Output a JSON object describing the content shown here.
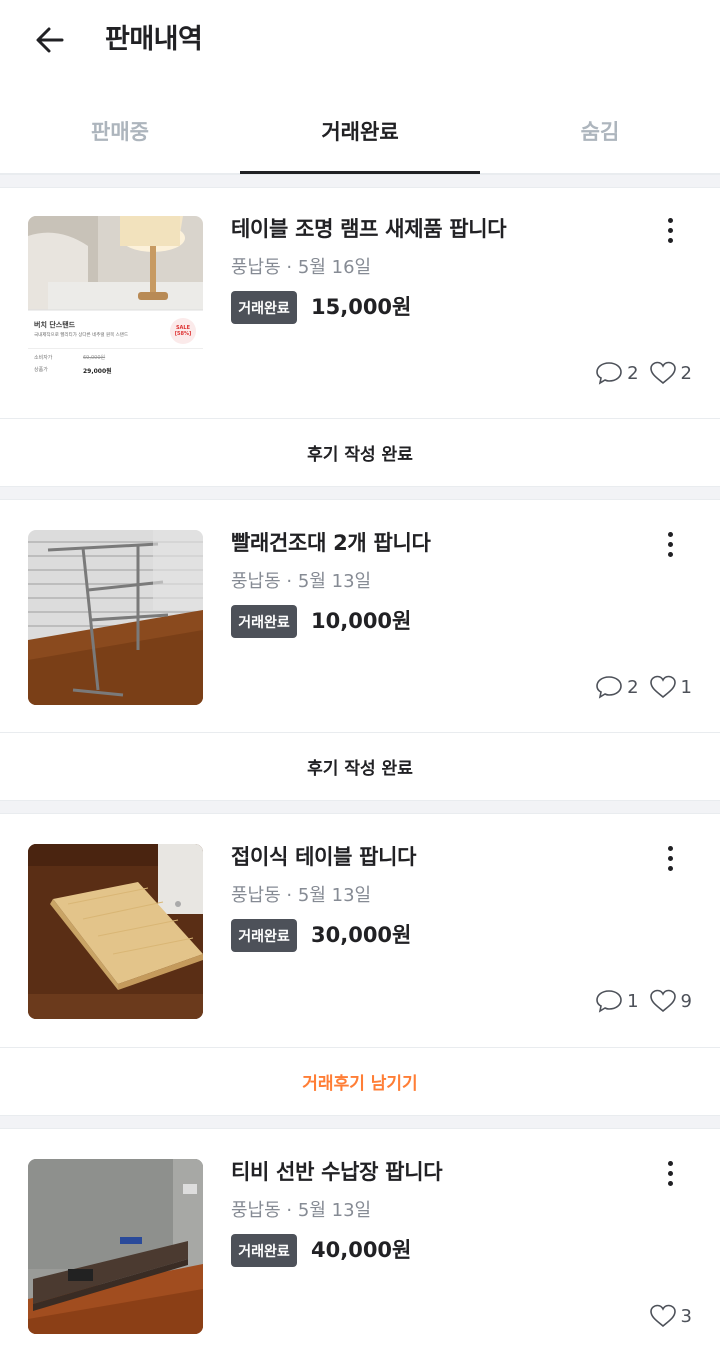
{
  "header": {
    "title": "판매내역"
  },
  "tabs": [
    {
      "label": "판매중",
      "active": false
    },
    {
      "label": "거래완료",
      "active": true
    },
    {
      "label": "숨김",
      "active": false
    }
  ],
  "items": [
    {
      "title": "테이블 조명 램프 새제품 팝니다",
      "location": "풍납동",
      "date": "5월 16일",
      "badge": "거래완료",
      "price": "15,000원",
      "comments": "2",
      "likes": "2",
      "thumb": {
        "product": "버치 단스탠드",
        "desc": "국내제작으로 헬리티가 상다른 네추럴 원목 스탠드",
        "sale": "SALE",
        "discount": "[58%]",
        "consumer_label": "소비자가",
        "consumer_price": "69,000원",
        "sale_label": "상품가",
        "sale_price": "29,000원"
      },
      "action": "후기 작성 완료"
    },
    {
      "title": "빨래건조대 2개 팝니다",
      "location": "풍납동",
      "date": "5월 13일",
      "badge": "거래완료",
      "price": "10,000원",
      "comments": "2",
      "likes": "1",
      "action": "후기 작성 완료"
    },
    {
      "title": "접이식 테이블 팝니다",
      "location": "풍납동",
      "date": "5월 13일",
      "badge": "거래완료",
      "price": "30,000원",
      "comments": "1",
      "likes": "9",
      "action": "거래후기 남기기"
    },
    {
      "title": "티비 선반 수납장 팝니다",
      "location": "풍납동",
      "date": "5월 13일",
      "badge": "거래완료",
      "price": "40,000원",
      "likes": "3"
    }
  ],
  "meta_separator": "·",
  "colors": {
    "accent": "#ff7e36",
    "badge": "#4d5159",
    "text": "#212124",
    "muted": "#868b94"
  }
}
